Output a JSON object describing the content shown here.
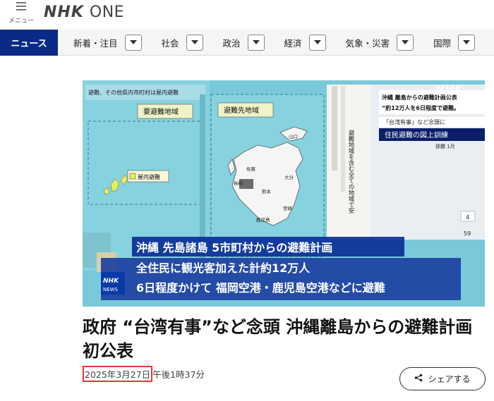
{
  "header": {
    "menu_icon": "hamburger-icon",
    "menu_label": "メニュー",
    "logo_nhk": "NHK",
    "logo_one": "ONE"
  },
  "nav": {
    "active": "ニュース",
    "items": [
      {
        "label": "新着・注目"
      },
      {
        "label": "社会"
      },
      {
        "label": "政治"
      },
      {
        "label": "経済"
      },
      {
        "label": "気象・災害"
      },
      {
        "label": "国際"
      }
    ]
  },
  "hero": {
    "corner_caption_1": "沖縄 離島からの避難計画公表",
    "corner_caption_2": "“約12万人を6日程度で避難。",
    "corner_caption_3": "「台湾有事」など念頭に",
    "corner_subcaption": "住民避難の図上訓練",
    "corner_small": "那覇 1月",
    "map_label_left": "要避難地域",
    "map_label_right": "避難先地域",
    "map_label_indoor": "屋内避難",
    "map_note": "避難、その他県内市町村は屋内避難",
    "pref_saga": "佐賀",
    "pref_nagasaki": "長崎",
    "pref_kumamoto": "熊本",
    "pref_oita": "大分",
    "pref_miyazaki": "宮崎",
    "pref_kagoshima": "鹿児島",
    "pref_yamaguchi": "山口",
    "num_4": "4",
    "num_59": "59",
    "vertical_text": "避難地域を含む全ての地域で安",
    "caption_line1": "沖縄 先島諸島 5市町村からの避難計画",
    "caption_line2": "全住民に観光客加えた計約12万人",
    "caption_line3": "6日程度かけて 福岡空港・鹿児島空港などに避難",
    "badge_top": "NHK",
    "badge_bottom": "NEWS",
    "watermark": "NHK"
  },
  "article": {
    "headline": "政府 “台湾有事”など念頭 沖縄離島からの避難計画 初公表",
    "date": "2025年3月27日",
    "time": "午後1時37分",
    "share_label": "シェアする",
    "share_icon": "share-icon"
  },
  "colors": {
    "nav_active_bg": "#0a2a86",
    "date_highlight": "#ee3333",
    "caption_bg": "#0b2f96"
  }
}
